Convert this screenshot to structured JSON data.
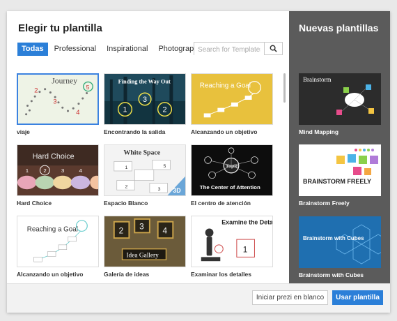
{
  "dialog": {
    "title": "Elegir tu plantilla",
    "tabs": [
      {
        "label": "Todas",
        "active": true
      },
      {
        "label": "Professional",
        "active": false
      },
      {
        "label": "Inspirational",
        "active": false
      },
      {
        "label": "Photographic",
        "active": false
      }
    ],
    "search": {
      "placeholder": "Search for Templates",
      "icon": "search-icon"
    },
    "templates": [
      {
        "label": "viaje",
        "thumb_text": "Journey",
        "selected": true
      },
      {
        "label": "Encontrando la salida",
        "thumb_text": "Finding the Way Out"
      },
      {
        "label": "Alcanzando un objetivo",
        "thumb_text": "Reaching a Goal"
      },
      {
        "label": "Hard Choice",
        "thumb_text": "Hard Choice"
      },
      {
        "label": "Espacio Blanco",
        "thumb_text": "White Space"
      },
      {
        "label": "El centro de atención",
        "thumb_text": "The Center of Attention"
      },
      {
        "label": "Alcanzando un objetivo",
        "thumb_text": "Reaching a Goal"
      },
      {
        "label": "Galería de ideas",
        "thumb_text": "Idea Gallery"
      },
      {
        "label": "Examinar los detalles",
        "thumb_text": "Examine the Details"
      }
    ]
  },
  "sidebar": {
    "title": "Nuevas plantillas",
    "items": [
      {
        "label": "Mind Mapping",
        "thumb_text": "Brainstorm"
      },
      {
        "label": "Brainstorm Freely",
        "thumb_text": "BRAINSTORM FREELY"
      },
      {
        "label": "Brainstorm with Cubes",
        "thumb_text": "Brainstorm with Cubes"
      }
    ]
  },
  "footer": {
    "blank_button": "Iniciar prezi en blanco",
    "use_button": "Usar plantilla"
  },
  "colors": {
    "accent": "#2b7fd8",
    "sidebar": "#5b5b5b"
  }
}
